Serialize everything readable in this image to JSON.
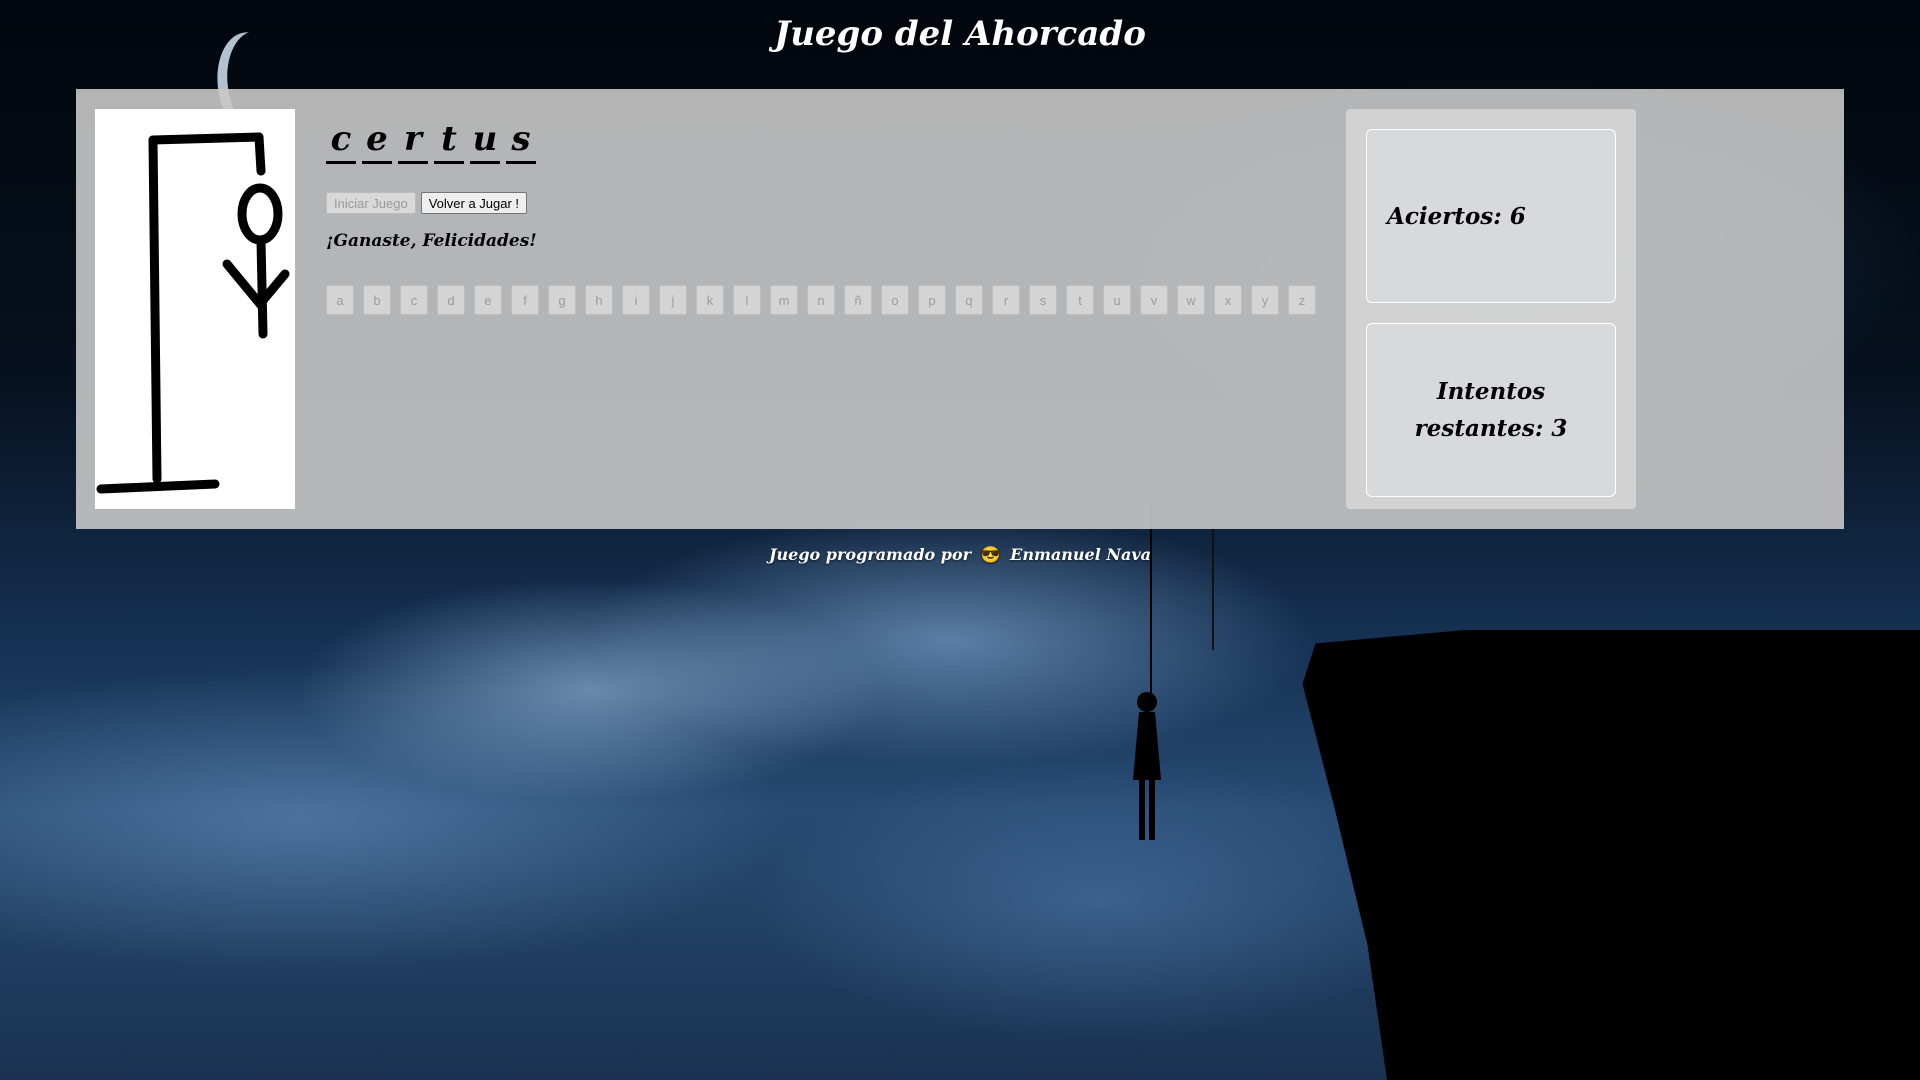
{
  "page": {
    "title": "Juego del Ahorcado"
  },
  "word": {
    "letters": [
      "c",
      "e",
      "r",
      "t",
      "u",
      "s"
    ]
  },
  "buttons": {
    "start_label": "Iniciar Juego",
    "replay_label": "Volver a Jugar !"
  },
  "status": {
    "message": "¡Ganaste, Felicidades!"
  },
  "alphabet": [
    "a",
    "b",
    "c",
    "d",
    "e",
    "f",
    "g",
    "h",
    "i",
    "j",
    "k",
    "l",
    "m",
    "n",
    "ñ",
    "o",
    "p",
    "q",
    "r",
    "s",
    "t",
    "u",
    "v",
    "w",
    "x",
    "y",
    "z"
  ],
  "score": {
    "hits_text": "Aciertos: 6",
    "remaining_text": "Intentos restantes: 3"
  },
  "footer": {
    "prefix": "Juego programado por",
    "emoji": "😎",
    "author": "Enmanuel Nava"
  },
  "colors": {
    "panel": "#c8c8c8",
    "title": "#ffffff",
    "key_disabled": "#d4d4d4"
  }
}
